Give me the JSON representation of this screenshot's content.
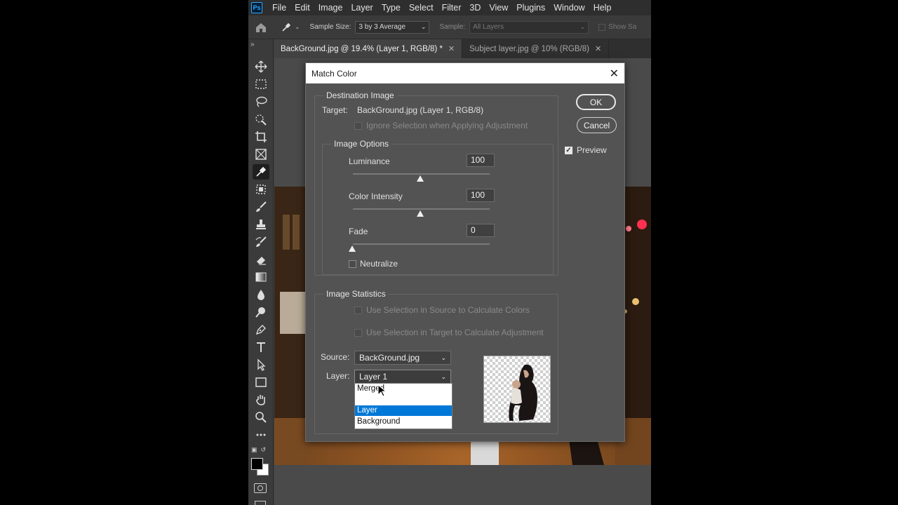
{
  "app": {
    "logo": "Ps",
    "menu": [
      "File",
      "Edit",
      "Image",
      "Layer",
      "Type",
      "Select",
      "Filter",
      "3D",
      "View",
      "Plugins",
      "Window",
      "Help"
    ]
  },
  "options_bar": {
    "sample_size_label": "Sample Size:",
    "sample_size_value": "3 by 3 Average",
    "sample_label": "Sample:",
    "sample_value": "All Layers",
    "show_label": "Show Sa"
  },
  "tabs": [
    {
      "label": "BackGround.jpg @ 19.4% (Layer 1, RGB/8) *",
      "active": true
    },
    {
      "label": "Subject layer.jpg @ 10% (RGB/8)",
      "active": false
    }
  ],
  "tools": [
    "move-tool-icon",
    "marquee-tool-icon",
    "lasso-tool-icon",
    "quick-selection-tool-icon",
    "crop-tool-icon",
    "frame-tool-icon",
    "eyedropper-tool-icon",
    "spot-healing-tool-icon",
    "brush-tool-icon",
    "clone-stamp-tool-icon",
    "history-brush-tool-icon",
    "eraser-tool-icon",
    "gradient-tool-icon",
    "blur-tool-icon",
    "dodge-tool-icon",
    "pen-tool-icon",
    "type-tool-icon",
    "path-selection-tool-icon",
    "rectangle-tool-icon",
    "hand-tool-icon",
    "zoom-tool-icon",
    "more-tools-icon"
  ],
  "dialog": {
    "title": "Match Color",
    "ok_label": "OK",
    "cancel_label": "Cancel",
    "preview_label": "Preview",
    "preview_checked": true,
    "destination": {
      "title": "Destination Image",
      "target_label": "Target:",
      "target_value": "BackGround.jpg (Layer 1, RGB/8)",
      "ignore_selection_label": "Ignore Selection when Applying Adjustment"
    },
    "image_options": {
      "title": "Image Options",
      "luminance_label": "Luminance",
      "luminance_value": "100",
      "color_intensity_label": "Color Intensity",
      "color_intensity_value": "100",
      "fade_label": "Fade",
      "fade_value": "0",
      "neutralize_label": "Neutralize"
    },
    "image_statistics": {
      "title": "Image Statistics",
      "use_source_label": "Use Selection in Source to Calculate Colors",
      "use_target_label": "Use Selection in Target to Calculate Adjustment",
      "source_label": "Source:",
      "source_value": "BackGround.jpg",
      "layer_label": "Layer:",
      "layer_value": "Layer 1",
      "layer_options": [
        "Merged",
        "Layer 1",
        "Background"
      ],
      "layer_option_highlight": "Layer"
    }
  },
  "colors": {
    "ui_bg": "#424242",
    "dialog_bg": "#535353",
    "highlight": "#0078d7"
  }
}
